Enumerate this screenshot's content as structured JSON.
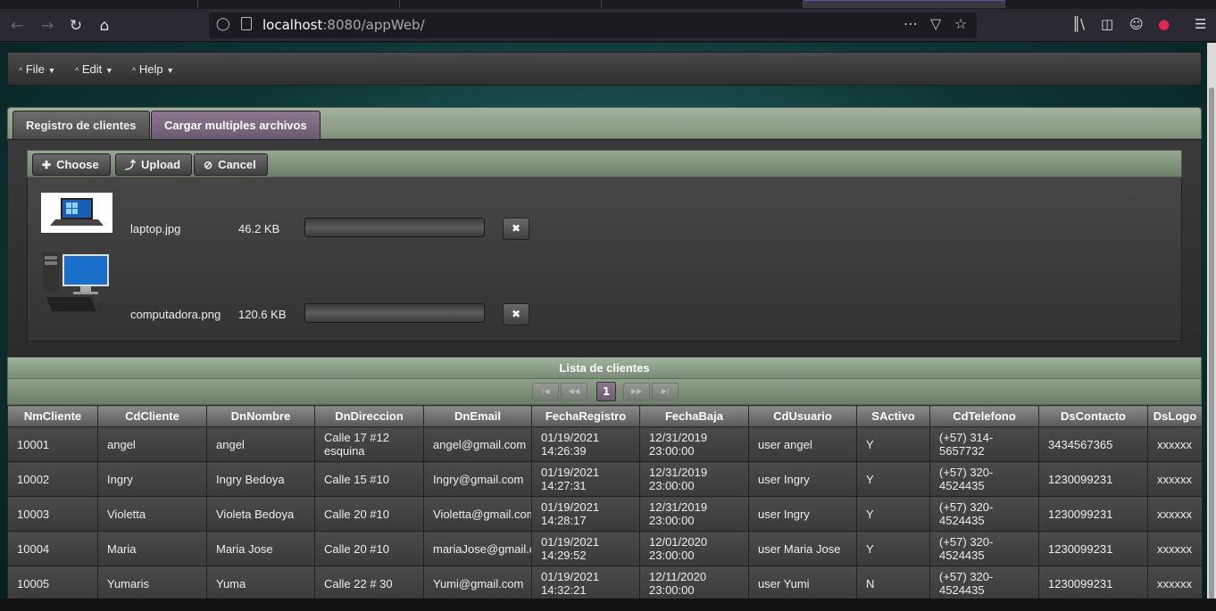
{
  "browser": {
    "url_host": "localhost",
    "url_rest": ":8080/appWeb/"
  },
  "menu": {
    "items": [
      {
        "label": "File"
      },
      {
        "label": "Edit"
      },
      {
        "label": "Help"
      }
    ]
  },
  "tabs": [
    {
      "label": "Registro de clientes",
      "active": false
    },
    {
      "label": "Cargar multiples archivos",
      "active": true
    }
  ],
  "fileupload": {
    "choose_label": "Choose",
    "upload_label": "Upload",
    "cancel_label": "Cancel",
    "files": [
      {
        "name": "laptop.jpg",
        "size": "46.2 KB"
      },
      {
        "name": "computadora.png",
        "size": "120.6 KB"
      }
    ]
  },
  "datatable": {
    "title": "Lista de clientes",
    "current_page": "1",
    "columns": [
      "NmCliente",
      "CdCliente",
      "DnNombre",
      "DnDireccion",
      "DnEmail",
      "FechaRegistro",
      "FechaBaja",
      "CdUsuario",
      "SActivo",
      "CdTelefono",
      "DsContacto",
      "DsLogo"
    ],
    "rows": [
      [
        "10001",
        "angel",
        "angel",
        "Calle 17 #12 esquina",
        "angel@gmail.com",
        "01/19/2021 14:26:39",
        "12/31/2019 23:00:00",
        "user angel",
        "Y",
        "(+57) 314-5657732",
        "3434567365",
        "xxxxxx"
      ],
      [
        "10002",
        "Ingry",
        "Ingry Bedoya",
        "Calle 15 #10",
        "Ingry@gmail.com",
        "01/19/2021 14:27:31",
        "12/31/2019 23:00:00",
        "user Ingry",
        "Y",
        "(+57) 320-4524435",
        "1230099231",
        "xxxxxx"
      ],
      [
        "10003",
        "Violetta",
        "Violeta Bedoya",
        "Calle 20 #10",
        "Violetta@gmail.com",
        "01/19/2021 14:28:17",
        "12/31/2019 23:00:00",
        "user Ingry",
        "Y",
        "(+57) 320-4524435",
        "1230099231",
        "xxxxxx"
      ],
      [
        "10004",
        "Maria",
        "Maria Jose",
        "Calle 20 #10",
        "mariaJose@gmail.com",
        "01/19/2021 14:29:52",
        "12/01/2020 23:00:00",
        "user Maria Jose",
        "Y",
        "(+57) 320-4524435",
        "1230099231",
        "xxxxxx"
      ],
      [
        "10005",
        "Yumaris",
        "Yuma",
        "Calle 22 # 30",
        "Yumi@gmail.com",
        "01/19/2021 14:32:21",
        "12/11/2020 23:00:00",
        "user Yumi",
        "N",
        "(+57) 320-4524435",
        "1230099231",
        "xxxxxx"
      ]
    ]
  }
}
